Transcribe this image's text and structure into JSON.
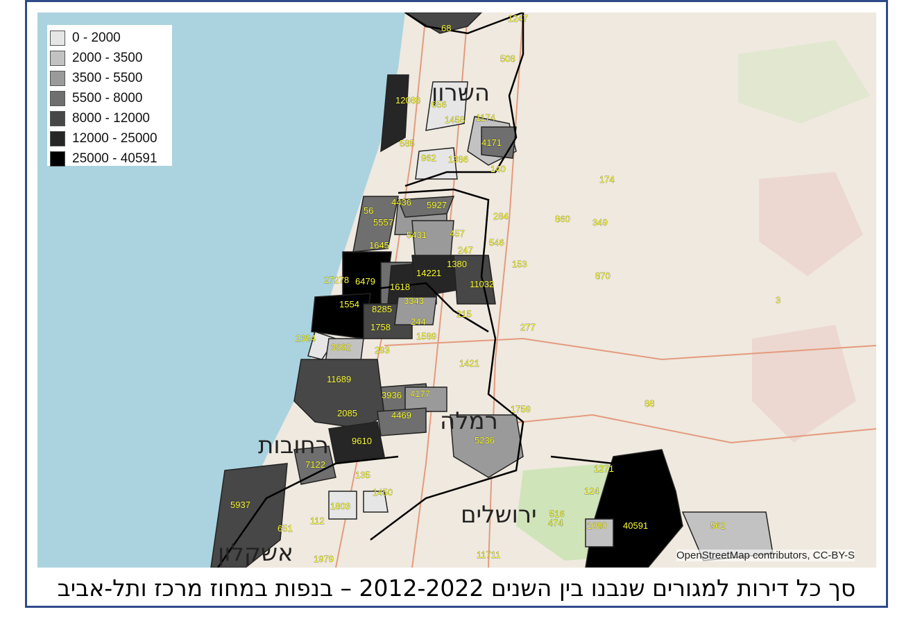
{
  "legend": {
    "items": [
      {
        "label": "0 - 2000",
        "color": "#e6e6e6"
      },
      {
        "label": "2000 - 3500",
        "color": "#c2c2c2"
      },
      {
        "label": "3500 - 5500",
        "color": "#9a9a9a"
      },
      {
        "label": "5500 - 8000",
        "color": "#6f6f6f"
      },
      {
        "label": "8000 - 12000",
        "color": "#474747"
      },
      {
        "label": "12000 - 25000",
        "color": "#262626"
      },
      {
        "label": "25000 - 40591",
        "color": "#000000"
      }
    ]
  },
  "regions": {
    "sharon": "השרון",
    "ramla": "רמלה",
    "rehovot": "רחובות",
    "jerusalem": "ירושלים",
    "ashkelon": "אשקלון"
  },
  "values": [
    "68",
    "1247",
    "508",
    "12088",
    "656",
    "1458",
    "1174",
    "585",
    "4171",
    "962",
    "1386",
    "140",
    "174",
    "4436",
    "5927",
    "56",
    "5557",
    "5431",
    "457",
    "284",
    "860",
    "349",
    "1645",
    "247",
    "546",
    "153",
    "27278",
    "6479",
    "1618",
    "14221",
    "1380",
    "11032",
    "870",
    "3",
    "1554",
    "8285",
    "3343",
    "215",
    "277",
    "2384",
    "1758",
    "244",
    "1589",
    "3992",
    "293",
    "1421",
    "11689",
    "3936",
    "4177",
    "88",
    "2085",
    "4469",
    "1759",
    "9610",
    "5236",
    "7122",
    "1271",
    "135",
    "124",
    "1450",
    "1803",
    "516",
    "474",
    "1080",
    "40591",
    "562",
    "5937",
    "112",
    "651",
    "1979",
    "11711"
  ],
  "attribution": "OpenStreetMap contributors, CC-BY-S",
  "caption": "סך כל דירות למגורים שנבנו בין השנים 2012-2022 – בנפות במחוז מרכז ותל-אביב",
  "colors": {
    "sea": "#aad3df",
    "land": "#efe9df",
    "border": "#2f4a8a"
  }
}
